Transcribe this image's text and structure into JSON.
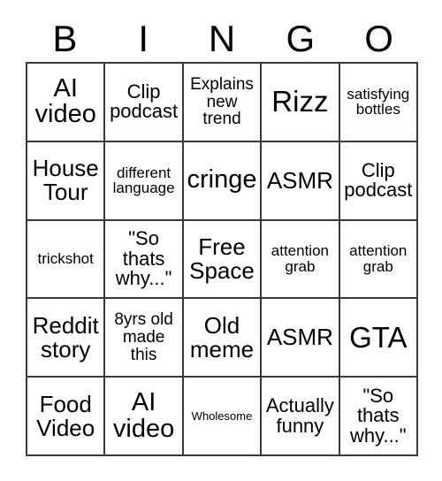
{
  "card": {
    "title": "BINGO",
    "header_letters": [
      "B",
      "I",
      "N",
      "G",
      "O"
    ],
    "grid_size": "5x5",
    "free_space_label": "Free Space",
    "colors": {
      "background": "#ffffff",
      "grid_line": "#3a3a3a",
      "text": "#000000"
    },
    "rows": [
      [
        {
          "text": "AI\nvideo",
          "size": "xl"
        },
        {
          "text": "Clip\npodcast",
          "size": "m"
        },
        {
          "text": "Explains\nnew\ntrend",
          "size": "s"
        },
        {
          "text": "Rizz",
          "size": "xxl"
        },
        {
          "text": "satisfying\nbottles",
          "size": "xs"
        }
      ],
      [
        {
          "text": "House\nTour",
          "size": "l"
        },
        {
          "text": "different\nlanguage",
          "size": "xs"
        },
        {
          "text": "cringe",
          "size": "xl"
        },
        {
          "text": "ASMR",
          "size": "l"
        },
        {
          "text": "Clip\npodcast",
          "size": "m"
        }
      ],
      [
        {
          "text": "trickshot",
          "size": "xs"
        },
        {
          "text": "\"So\nthats\nwhy...\"",
          "size": "m"
        },
        {
          "text": "Free\nSpace",
          "size": "l"
        },
        {
          "text": "attention\ngrab",
          "size": "xs"
        },
        {
          "text": "attention\ngrab",
          "size": "xs"
        }
      ],
      [
        {
          "text": "Reddit\nstory",
          "size": "l"
        },
        {
          "text": "8yrs old\nmade\nthis",
          "size": "s"
        },
        {
          "text": "Old\nmeme",
          "size": "l"
        },
        {
          "text": "ASMR",
          "size": "l"
        },
        {
          "text": "GTA",
          "size": "xxl"
        }
      ],
      [
        {
          "text": "Food\nVideo",
          "size": "l"
        },
        {
          "text": "AI\nvideo",
          "size": "xl"
        },
        {
          "text": "Wholesome",
          "size": "xxs"
        },
        {
          "text": "Actually\nfunny",
          "size": "m"
        },
        {
          "text": "\"So\nthats\nwhy...\"",
          "size": "m"
        }
      ]
    ]
  }
}
